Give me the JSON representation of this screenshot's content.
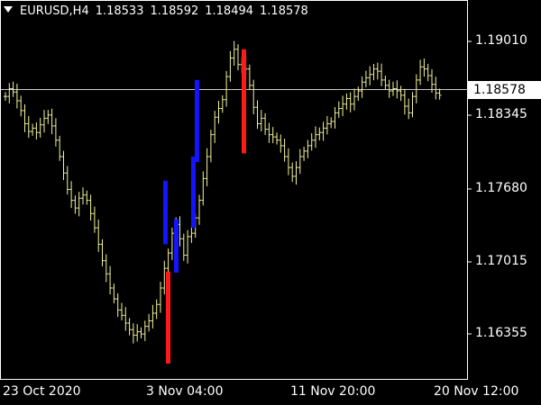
{
  "header": {
    "symbol": "EURUSD,H4",
    "open": "1.18533",
    "high": "1.18592",
    "low": "1.18494",
    "close": "1.18578"
  },
  "current_price": "1.18578",
  "y_axis": [
    "1.19010",
    "1.18345",
    "1.17680",
    "1.17015",
    "1.16355"
  ],
  "x_axis": [
    "23 Oct 2020",
    "3 Nov 04:00",
    "11 Nov 20:00",
    "20 Nov 12:00"
  ],
  "colors": {
    "background": "#000000",
    "bars": "#f3f39a",
    "bull_signal": "#1414ff",
    "bear_signal": "#ff1a1a",
    "axes": "#ffffff"
  },
  "chart_data": {
    "type": "ohlc",
    "symbol": "EURUSD",
    "timeframe": "H4",
    "ylim": [
      1.1597,
      1.1943
    ],
    "current_price": 1.18578,
    "closes": [
      1.1855,
      1.1862,
      1.1859,
      1.1851,
      1.1842,
      1.183,
      1.1823,
      1.1826,
      1.1822,
      1.1829,
      1.1835,
      1.1838,
      1.1828,
      1.1815,
      1.18,
      1.1785,
      1.177,
      1.176,
      1.1753,
      1.1762,
      1.1765,
      1.176,
      1.1748,
      1.1735,
      1.172,
      1.1705,
      1.1693,
      1.168,
      1.167,
      1.166,
      1.1655,
      1.1648,
      1.1642,
      1.1637,
      1.164,
      1.1638,
      1.1645,
      1.165,
      1.1657,
      1.1665,
      1.168,
      1.1698,
      1.1712,
      1.173,
      1.1738,
      1.1725,
      1.171,
      1.1727,
      1.173,
      1.1744,
      1.176,
      1.178,
      1.18,
      1.182,
      1.1836,
      1.1844,
      1.1852,
      1.1873,
      1.189,
      1.1898,
      1.1884,
      1.1885,
      1.188,
      1.1865,
      1.1845,
      1.183,
      1.1835,
      1.1825,
      1.182,
      1.1818,
      1.1815,
      1.181,
      1.18,
      1.179,
      1.1782,
      1.179,
      1.18,
      1.1805,
      1.181,
      1.1815,
      1.182,
      1.1822,
      1.1826,
      1.183,
      1.1832,
      1.184,
      1.1844,
      1.1848,
      1.1853,
      1.1848,
      1.1855,
      1.186,
      1.1868,
      1.1872,
      1.1875,
      1.188,
      1.1878,
      1.187,
      1.1865,
      1.186,
      1.1862,
      1.186,
      1.1856,
      1.1846,
      1.184,
      1.1855,
      1.187,
      1.1882,
      1.188,
      1.1874,
      1.1866,
      1.1858,
      1.1856
    ],
    "signals": [
      {
        "type": "bull",
        "low": 1.172,
        "high": 1.1778
      },
      {
        "type": "bear",
        "low": 1.1611,
        "high": 1.1695
      },
      {
        "type": "bull",
        "low": 1.1694,
        "high": 1.1743
      },
      {
        "type": "bull",
        "low": 1.1735,
        "high": 1.18
      },
      {
        "type": "bull",
        "low": 1.1795,
        "high": 1.187
      },
      {
        "type": "bear",
        "low": 1.1803,
        "high": 1.1898
      }
    ]
  }
}
